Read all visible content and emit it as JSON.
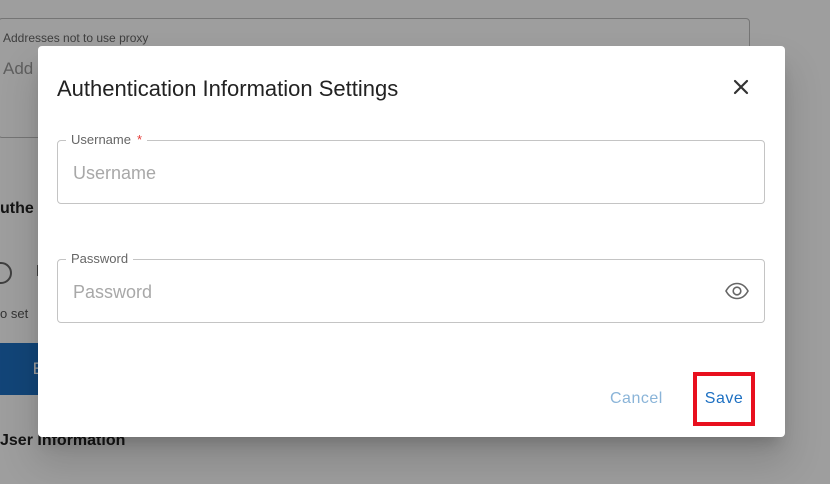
{
  "background": {
    "proxy_exclusions_label": "Addresses not to use proxy",
    "proxy_exclusions_placeholder": "Add",
    "auth_heading_fragment": "uthe",
    "radio_label_fragment": "N",
    "hint_fragment": "o set",
    "blue_button_fragment": "E",
    "user_info_heading_fragment": "Jser Information"
  },
  "dialog": {
    "title": "Authentication Information Settings",
    "close_icon": "close-icon",
    "username": {
      "label": "Username",
      "required_marker": "*",
      "placeholder": "Username",
      "value": ""
    },
    "password": {
      "label": "Password",
      "placeholder": "Password",
      "value": "",
      "toggle_icon": "eye-icon"
    },
    "cancel_label": "Cancel",
    "save_label": "Save"
  },
  "colors": {
    "primary": "#1d70c2",
    "highlight": "#e8101e",
    "required": "#e53935",
    "cancel": "#8ab4d8"
  }
}
